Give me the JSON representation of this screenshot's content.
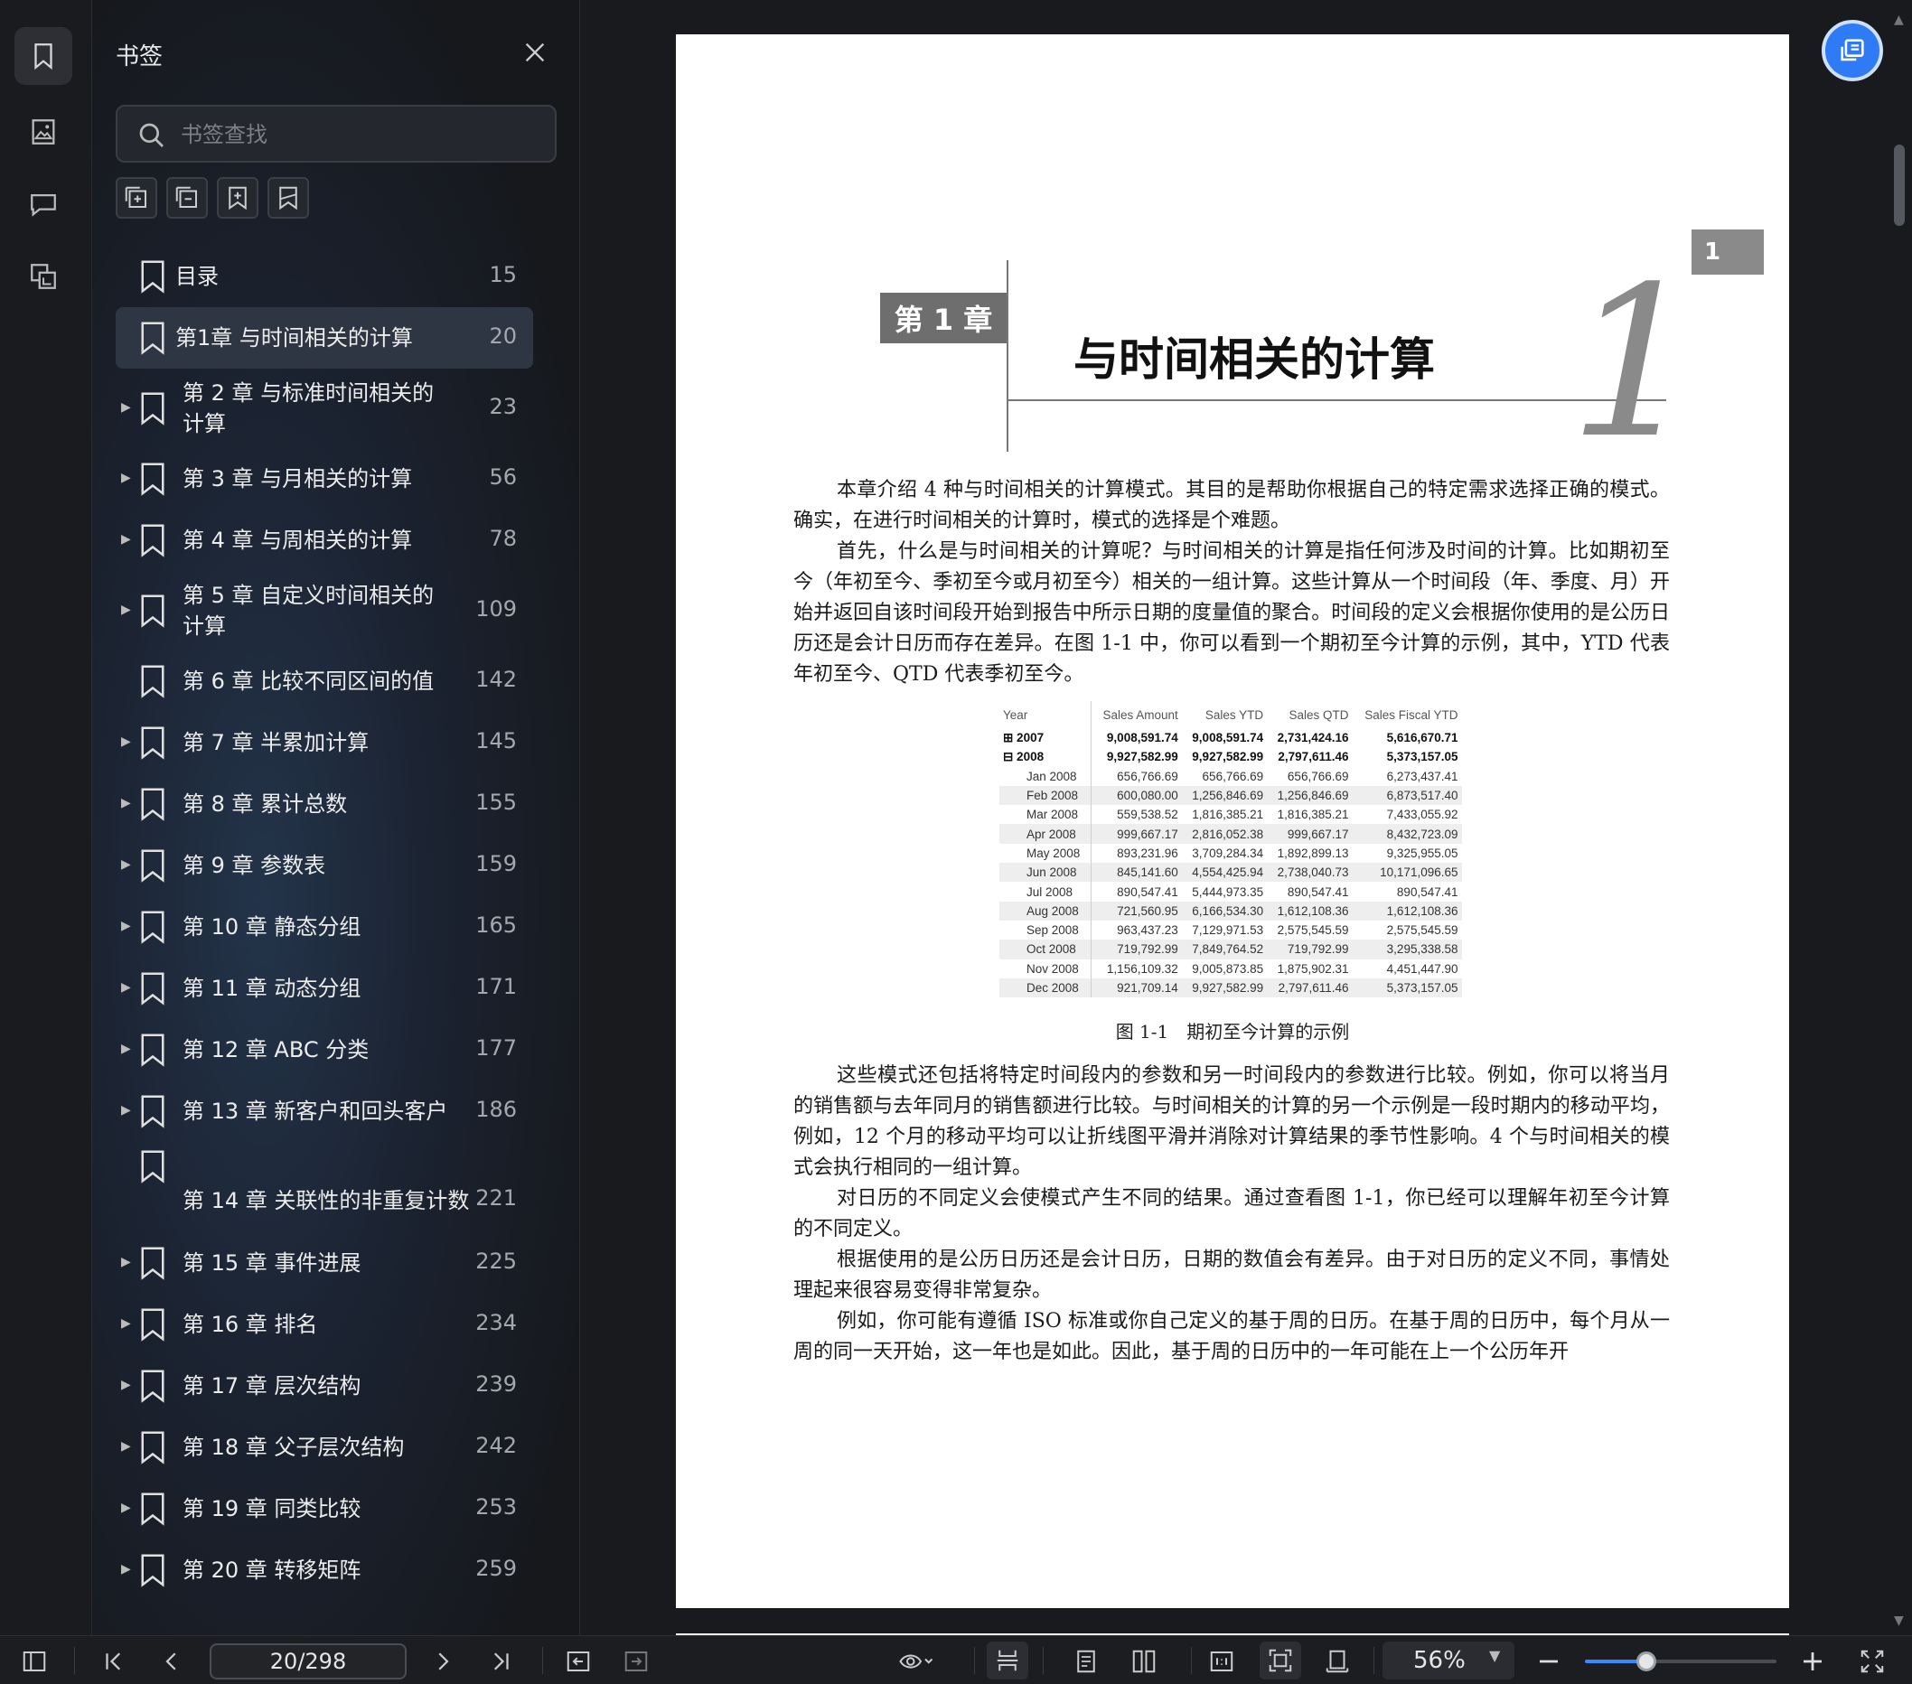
{
  "panel": {
    "title": "书签",
    "search_placeholder": "书签查找",
    "items": [
      {
        "label": "目录",
        "page": "15",
        "expandable": false,
        "selected": false
      },
      {
        "label": "第1章 与时间相关的计算",
        "page": "20",
        "expandable": false,
        "selected": true
      },
      {
        "label": "第 2 章 与标准时间相关的计算",
        "page": "23",
        "expandable": true,
        "selected": false
      },
      {
        "label": "第 3 章 与月相关的计算",
        "page": "56",
        "expandable": true,
        "selected": false
      },
      {
        "label": "第 4 章 与周相关的计算",
        "page": "78",
        "expandable": true,
        "selected": false
      },
      {
        "label": "第 5 章 自定义时间相关的计算",
        "page": "109",
        "expandable": true,
        "selected": false
      },
      {
        "label": "第 6 章 比较不同区间的值",
        "page": "142",
        "expandable": false,
        "selected": false
      },
      {
        "label": "第 7 章 半累加计算",
        "page": "145",
        "expandable": true,
        "selected": false
      },
      {
        "label": "第 8 章 累计总数",
        "page": "155",
        "expandable": true,
        "selected": false
      },
      {
        "label": "第 9 章 参数表",
        "page": "159",
        "expandable": true,
        "selected": false
      },
      {
        "label": "第 10 章 静态分组",
        "page": "165",
        "expandable": true,
        "selected": false
      },
      {
        "label": "第 11 章 动态分组",
        "page": "171",
        "expandable": true,
        "selected": false
      },
      {
        "label": "第 12 章 ABC 分类",
        "page": "177",
        "expandable": true,
        "selected": false
      },
      {
        "label": "第 13 章 新客户和回头客户",
        "page": "186",
        "expandable": true,
        "selected": false
      },
      {
        "label": "第 14 章 关联性的非重复计数",
        "page": "221",
        "expandable": false,
        "selected": false
      },
      {
        "label": "第 15 章 事件进展",
        "page": "225",
        "expandable": true,
        "selected": false
      },
      {
        "label": "第 16 章 排名",
        "page": "234",
        "expandable": true,
        "selected": false
      },
      {
        "label": "第 17 章 层次结构",
        "page": "239",
        "expandable": true,
        "selected": false
      },
      {
        "label": "第 18 章 父子层次结构",
        "page": "242",
        "expandable": true,
        "selected": false
      },
      {
        "label": "第 19 章 同类比较",
        "page": "253",
        "expandable": true,
        "selected": false
      },
      {
        "label": "第 20 章 转移矩阵",
        "page": "259",
        "expandable": true,
        "selected": false
      }
    ]
  },
  "document": {
    "chapter_badge": "第 1 章",
    "chapter_title": "与时间相关的计算",
    "big_number": "1",
    "tab_number": "1",
    "intro_paragraphs": [
      "本章介绍 4 种与时间相关的计算模式。其目的是帮助你根据自己的特定需求选择正确的模式。确实，在进行时间相关的计算时，模式的选择是个难题。",
      "首先，什么是与时间相关的计算呢？与时间相关的计算是指任何涉及时间的计算。比如期初至今（年初至今、季初至今或月初至今）相关的一组计算。这些计算从一个时间段（年、季度、月）开始并返回自该时间段开始到报告中所示日期的度量值的聚合。时间段的定义会根据你使用的是公历日历还是会计日历而存在差异。在图 1-1 中，你可以看到一个期初至今计算的示例，其中，YTD 代表年初至今、QTD 代表季初至今。"
    ],
    "table": {
      "headers": [
        "Year",
        "Sales Amount",
        "Sales YTD",
        "Sales QTD",
        "Sales Fiscal YTD"
      ],
      "rows": [
        {
          "year": "⊞ 2007",
          "bold": true,
          "cells": [
            "9,008,591.74",
            "9,008,591.74",
            "2,731,424.16",
            "5,616,670.71"
          ]
        },
        {
          "year": "⊟ 2008",
          "bold": true,
          "cells": [
            "9,927,582.99",
            "9,927,582.99",
            "2,797,611.46",
            "5,373,157.05"
          ]
        },
        {
          "year": "Jan 2008",
          "bold": false,
          "cells": [
            "656,766.69",
            "656,766.69",
            "656,766.69",
            "6,273,437.41"
          ]
        },
        {
          "year": "Feb 2008",
          "bold": false,
          "cells": [
            "600,080.00",
            "1,256,846.69",
            "1,256,846.69",
            "6,873,517.40"
          ]
        },
        {
          "year": "Mar 2008",
          "bold": false,
          "cells": [
            "559,538.52",
            "1,816,385.21",
            "1,816,385.21",
            "7,433,055.92"
          ]
        },
        {
          "year": "Apr 2008",
          "bold": false,
          "cells": [
            "999,667.17",
            "2,816,052.38",
            "999,667.17",
            "8,432,723.09"
          ]
        },
        {
          "year": "May 2008",
          "bold": false,
          "cells": [
            "893,231.96",
            "3,709,284.34",
            "1,892,899.13",
            "9,325,955.05"
          ]
        },
        {
          "year": "Jun 2008",
          "bold": false,
          "cells": [
            "845,141.60",
            "4,554,425.94",
            "2,738,040.73",
            "10,171,096.65"
          ]
        },
        {
          "year": "Jul 2008",
          "bold": false,
          "cells": [
            "890,547.41",
            "5,444,973.35",
            "890,547.41",
            "890,547.41"
          ]
        },
        {
          "year": "Aug 2008",
          "bold": false,
          "cells": [
            "721,560.95",
            "6,166,534.30",
            "1,612,108.36",
            "1,612,108.36"
          ]
        },
        {
          "year": "Sep 2008",
          "bold": false,
          "cells": [
            "963,437.23",
            "7,129,971.53",
            "2,575,545.59",
            "2,575,545.59"
          ]
        },
        {
          "year": "Oct 2008",
          "bold": false,
          "cells": [
            "719,792.99",
            "7,849,764.52",
            "719,792.99",
            "3,295,338.58"
          ]
        },
        {
          "year": "Nov 2008",
          "bold": false,
          "cells": [
            "1,156,109.32",
            "9,005,873.85",
            "1,875,902.31",
            "4,451,447.90"
          ]
        },
        {
          "year": "Dec 2008",
          "bold": false,
          "cells": [
            "921,709.14",
            "9,927,582.99",
            "2,797,611.46",
            "5,373,157.05"
          ]
        }
      ]
    },
    "caption": "图 1-1　期初至今计算的示例",
    "body_paragraphs": [
      "这些模式还包括将特定时间段内的参数和另一时间段内的参数进行比较。例如，你可以将当月的销售额与去年同月的销售额进行比较。与时间相关的计算的另一个示例是一段时期内的移动平均，例如，12 个月的移动平均可以让折线图平滑并消除对计算结果的季节性影响。4 个与时间相关的模式会执行相同的一组计算。",
      "对日历的不同定义会使模式产生不同的结果。通过查看图 1-1，你已经可以理解年初至今计算的不同定义。",
      "根据使用的是公历日历还是会计日历，日期的数值会有差异。由于对日历的定义不同，事情处理起来很容易变得非常复杂。",
      "例如，你可能有遵循 ISO 标准或你自己定义的基于周的日历。在基于周的日历中，每个月从一周的同一天开始，这一年也是如此。因此，基于周的日历中的一年可能在上一个公历年开"
    ]
  },
  "toolbar": {
    "page_indicator": "20/298",
    "zoom_label": "56%",
    "zoom_fraction": 0.32
  },
  "colors": {
    "accent": "#2f7bf5",
    "selected_item_bg": "#2e3643",
    "page_bg": "#ffffff"
  }
}
